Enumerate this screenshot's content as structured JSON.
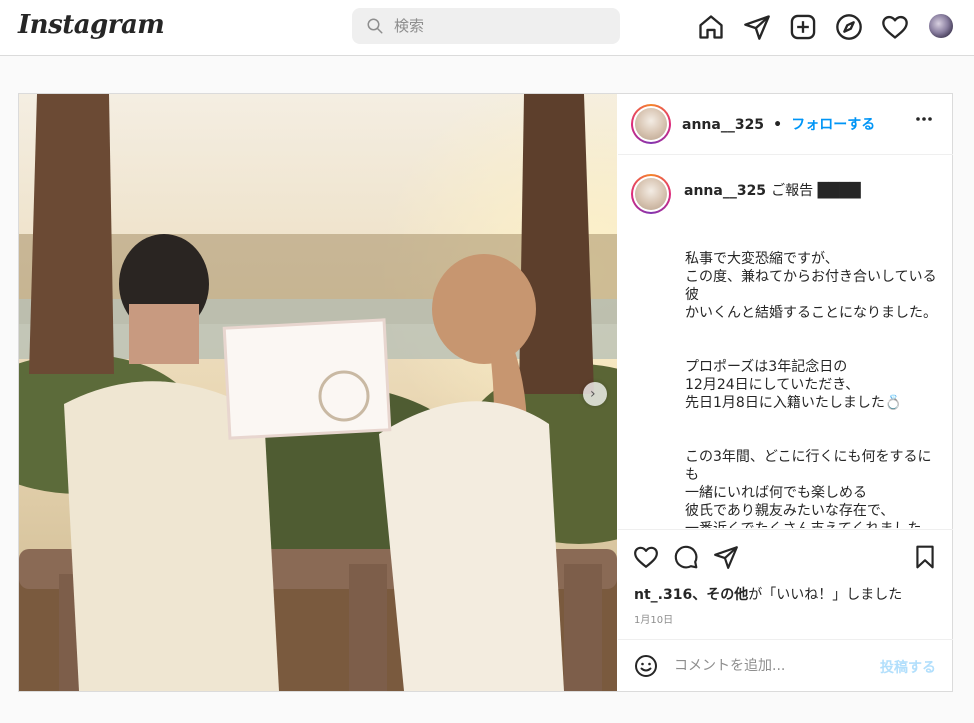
{
  "topbar": {
    "logo": "Instagram",
    "search_placeholder": "検索",
    "icons": [
      "home-icon",
      "send-icon",
      "new-post-icon",
      "explore-icon",
      "heart-icon"
    ]
  },
  "post": {
    "username": "anna__325",
    "separator": "•",
    "follow_label": "フォローする",
    "caption_user": "anna__325",
    "caption_first": "ご報告 ████",
    "caption_lines": [
      "私事で大変恐縮ですが、",
      "この度、兼ねてからお付き合いしている",
      "彼",
      "かいくんと結婚することになりました。",
      "",
      "",
      "プロポーズは3年記念日の",
      "12月24日にしていただき、",
      "先日1月8日に入籍いたしました💍",
      "",
      "",
      "この3年間、どこに行くにも何をするに",
      "も",
      "一緒にいれば何でも楽しめる",
      "彼氏であり親友みたいな存在で、",
      "一番近くでたくさん支えてくれました。"
    ],
    "likes_user": "nt_.316",
    "likes_mid": "、",
    "likes_others": "その他",
    "likes_suffix": "が「いいね！」しました",
    "date": "1月10日",
    "comment_placeholder": "コメントを追加...",
    "post_button": "投稿する"
  },
  "colors": {
    "accent": "#0095f6",
    "post_button_disabled": "#b2dffc",
    "border": "#dbdbdb",
    "background": "#fafafa"
  }
}
